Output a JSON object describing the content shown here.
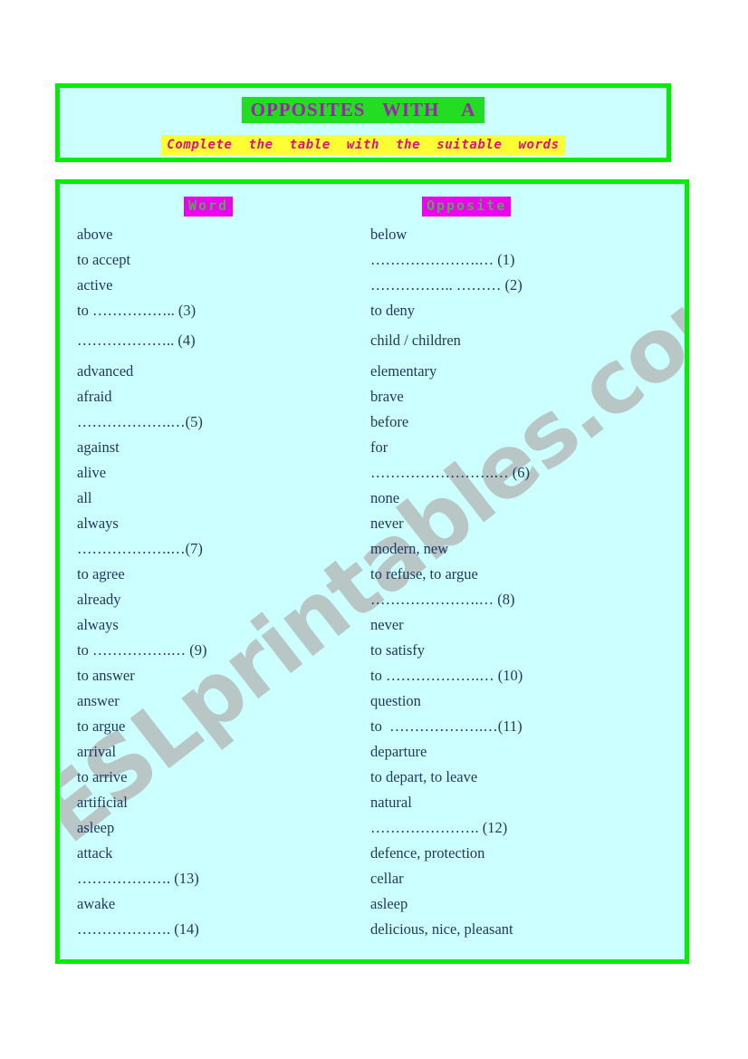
{
  "header": {
    "title": "OPPOSITES   WITH    A",
    "subtitle": "Complete  the  table  with  the  suitable  words"
  },
  "watermark": {
    "text": "ESLprintables.com"
  },
  "table": {
    "headers": {
      "word": "Word",
      "opposite": "Opposite"
    },
    "rows": [
      {
        "word": "above",
        "opposite": "below"
      },
      {
        "word": "to accept",
        "opposite": "………………….… (1)"
      },
      {
        "word": "active",
        "opposite": "…………….. ……… (2)"
      },
      {
        "word": "to …………….. (3)",
        "opposite": "to deny"
      },
      {
        "word": "……………….. (4)",
        "opposite": "child / children"
      },
      {
        "word": "advanced",
        "opposite": "elementary"
      },
      {
        "word": "afraid",
        "opposite": "brave"
      },
      {
        "word": "……………….…(5)",
        "opposite": "before"
      },
      {
        "word": "against",
        "opposite": "for"
      },
      {
        "word": "alive",
        "opposite": "…………………….… (6)"
      },
      {
        "word": "all",
        "opposite": "none"
      },
      {
        "word": "always",
        "opposite": "never"
      },
      {
        "word": "……………….…(7)",
        "opposite": "modern, new"
      },
      {
        "word": "to agree",
        "opposite": "to refuse, to argue"
      },
      {
        "word": "already",
        "opposite": "………………….… (8)"
      },
      {
        "word": "always",
        "opposite": "never"
      },
      {
        "word": "to …………….… (9)",
        "opposite": "to satisfy"
      },
      {
        "word": "to answer",
        "opposite": "to ……………….… (10)"
      },
      {
        "word": "answer",
        "opposite": "question"
      },
      {
        "word": "to argue",
        "opposite": "to  ……………….…(11)"
      },
      {
        "word": "arrival",
        "opposite": "departure"
      },
      {
        "word": "to arrive",
        "opposite": "to depart, to leave"
      },
      {
        "word": "artificial",
        "opposite": "natural"
      },
      {
        "word": "asleep",
        "opposite": "…………………. (12)"
      },
      {
        "word": "attack",
        "opposite": "defence, protection"
      },
      {
        "word": "………………. (13)",
        "opposite": "cellar"
      },
      {
        "word": "awake",
        "opposite": "asleep"
      },
      {
        "word": "………………. (14)",
        "opposite": "delicious, nice, pleasant"
      }
    ]
  },
  "colors": {
    "page_background": "#ffffff",
    "panel_background": "#ccffff",
    "border_green": "#00ee00",
    "title_highlight": "#22dd22",
    "title_text": "#a020b0",
    "subtitle_highlight": "#ffff33",
    "subtitle_text": "#e01080",
    "header_highlight": "#ee00ee",
    "header_text": "#55aa55",
    "body_text": "#1f3864",
    "watermark": "#b9c6c6"
  }
}
